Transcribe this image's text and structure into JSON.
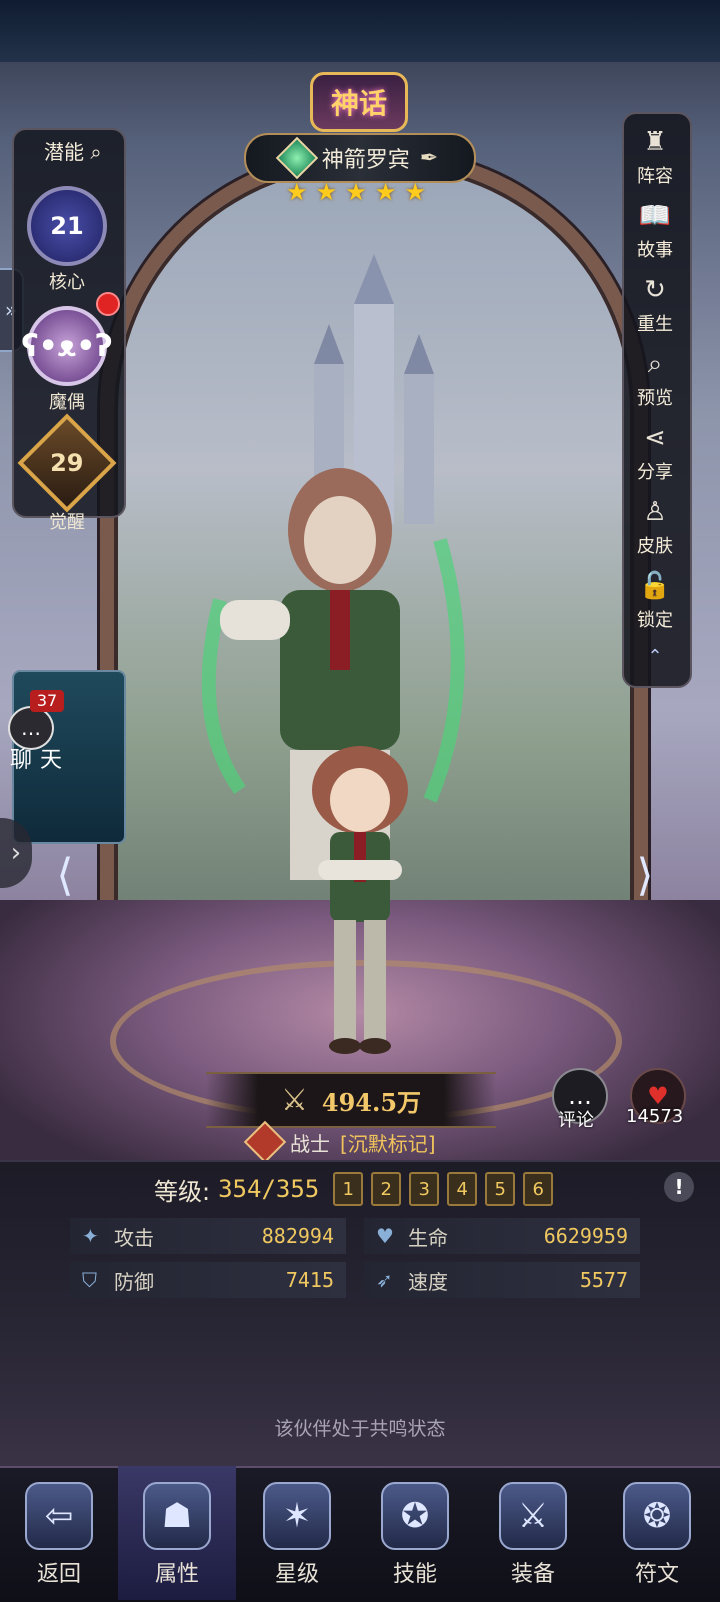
{
  "header": {
    "rarity": "神话",
    "hero_name": "神箭罗宾",
    "stars": [
      "★",
      "★",
      "★",
      "★",
      "★"
    ]
  },
  "left_panel": {
    "potential_label": "潜能",
    "core": {
      "value": "21",
      "label": "核心"
    },
    "puppet": {
      "label": "魔偶"
    },
    "awaken": {
      "value": "29",
      "label": "觉醒"
    }
  },
  "right_panel": [
    {
      "label": "阵容",
      "icon": "lineup-icon"
    },
    {
      "label": "故事",
      "icon": "story-book-icon"
    },
    {
      "label": "重生",
      "icon": "rebirth-icon"
    },
    {
      "label": "预览",
      "icon": "magnifier-icon"
    },
    {
      "label": "分享",
      "icon": "share-icon"
    },
    {
      "label": "皮肤",
      "icon": "skin-icon"
    },
    {
      "label": "锁定",
      "icon": "lock-icon"
    }
  ],
  "chat": {
    "badge": "37",
    "label": "聊天"
  },
  "power": {
    "value": "494.5万"
  },
  "class_info": {
    "name": "战士",
    "tag": "[沉默标记]"
  },
  "social": {
    "comment_label": "评论",
    "likes": "14573"
  },
  "level": {
    "label": "等级:",
    "value": "354/355",
    "tiers": [
      "1",
      "2",
      "3",
      "4",
      "5",
      "6"
    ]
  },
  "stats": [
    {
      "label": "攻击",
      "value": "882994",
      "icon": "attack-icon"
    },
    {
      "label": "生命",
      "value": "6629959",
      "icon": "heart-icon"
    },
    {
      "label": "防御",
      "value": "7415",
      "icon": "shield-icon"
    },
    {
      "label": "速度",
      "value": "5577",
      "icon": "speed-icon"
    }
  ],
  "resonance_text": "该伙伴处于共鸣状态",
  "bottom_nav": [
    {
      "label": "返回",
      "icon": "back-arrow-icon"
    },
    {
      "label": "属性",
      "icon": "hooded-figure-icon"
    },
    {
      "label": "星级",
      "icon": "star-crest-icon"
    },
    {
      "label": "技能",
      "icon": "spellbook-icon"
    },
    {
      "label": "装备",
      "icon": "crossed-swords-icon"
    },
    {
      "label": "符文",
      "icon": "rune-crest-icon"
    }
  ],
  "colors": {
    "gold": "#f0c860",
    "star": "#ffcc1e",
    "alert": "#e02424"
  }
}
